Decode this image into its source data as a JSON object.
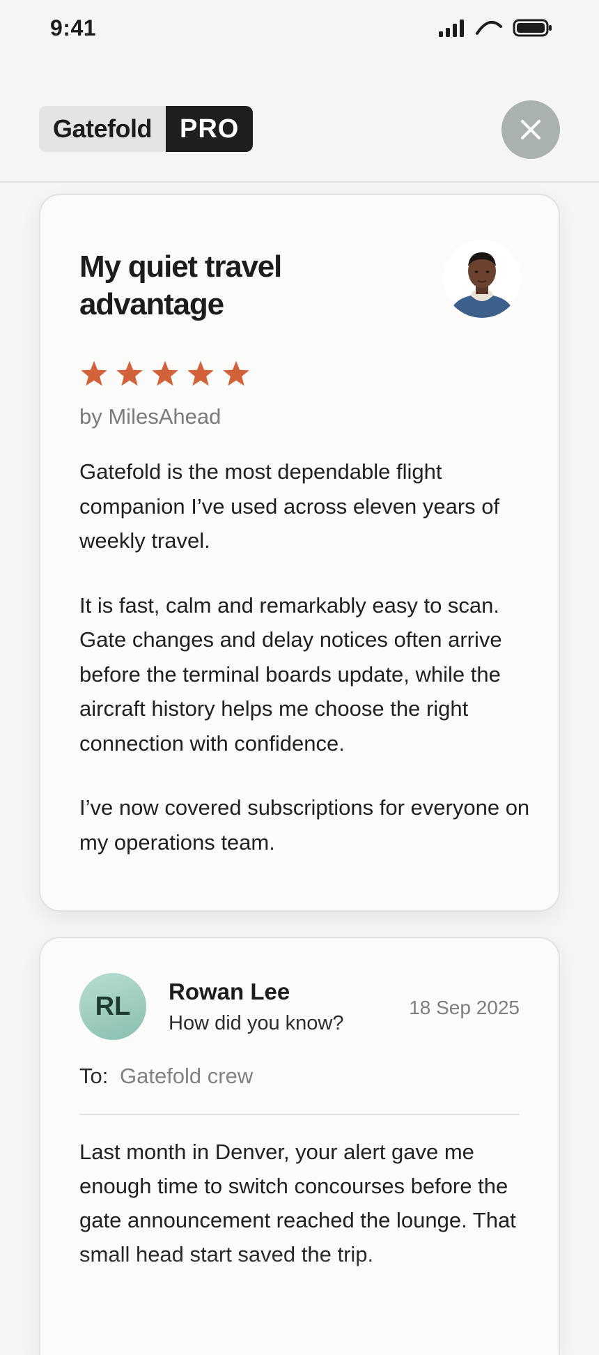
{
  "status_bar": {
    "time": "9:41"
  },
  "header": {
    "brand_name": "Gatefold",
    "brand_tier": "PRO",
    "close_icon": "close-icon"
  },
  "review": {
    "title": "My quiet travel advantage",
    "rating": 5,
    "rating_max": 5,
    "author": "by MilesAhead",
    "paragraphs": [
      "Gatefold is the most dependable flight companion I’ve used across eleven years of weekly travel.",
      "It is fast, calm and remarkably easy to scan. Gate changes and delay notices often arrive before the terminal boards update, while the aircraft history helps me choose the right connection with confidence.",
      "I’ve now covered subscriptions for everyone on my operations team."
    ]
  },
  "message": {
    "avatar_initials": "RL",
    "sender": "Rowan Lee",
    "subject": "How did you know?",
    "date": "18 Sep 2025",
    "to_label": "To:",
    "to_value": "Gatefold crew",
    "body": "Last month in Denver, your alert gave me enough time to switch concourses before the gate announcement reached the lounge. That small head start saved the trip."
  },
  "colors": {
    "star": "#d1623a",
    "avatar_bg": "#9fcfc2",
    "brand_dark": "#1d1e1d"
  }
}
